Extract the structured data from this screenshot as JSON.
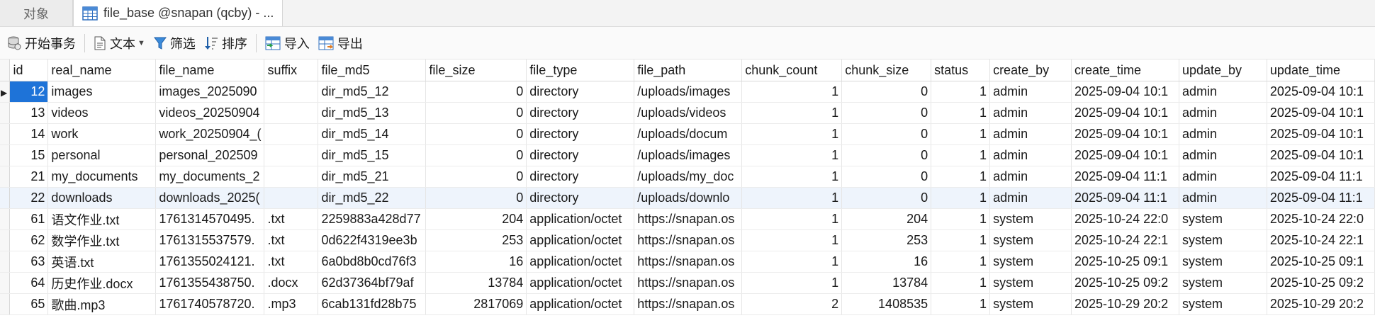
{
  "tabs": {
    "objects_label": "对象",
    "active_label": "file_base @snapan (qcby) - ..."
  },
  "toolbar": {
    "begin_tx": "开始事务",
    "text": "文本",
    "filter": "筛选",
    "sort": "排序",
    "import": "导入",
    "export": "导出"
  },
  "columns": [
    "id",
    "real_name",
    "file_name",
    "suffix",
    "file_md5",
    "file_size",
    "file_type",
    "file_path",
    "chunk_count",
    "chunk_size",
    "status",
    "create_by",
    "create_time",
    "update_by",
    "update_time"
  ],
  "rows": [
    [
      "12",
      "images",
      "images_2025090",
      "",
      "dir_md5_12",
      "0",
      "directory",
      "/uploads/images",
      "1",
      "0",
      "1",
      "admin",
      "2025-09-04 10:1",
      "admin",
      "2025-09-04 10:1"
    ],
    [
      "13",
      "videos",
      "videos_20250904",
      "",
      "dir_md5_13",
      "0",
      "directory",
      "/uploads/videos",
      "1",
      "0",
      "1",
      "admin",
      "2025-09-04 10:1",
      "admin",
      "2025-09-04 10:1"
    ],
    [
      "14",
      "work",
      "work_20250904_(",
      "",
      "dir_md5_14",
      "0",
      "directory",
      "/uploads/docum",
      "1",
      "0",
      "1",
      "admin",
      "2025-09-04 10:1",
      "admin",
      "2025-09-04 10:1"
    ],
    [
      "15",
      "personal",
      "personal_202509",
      "",
      "dir_md5_15",
      "0",
      "directory",
      "/uploads/images",
      "1",
      "0",
      "1",
      "admin",
      "2025-09-04 10:1",
      "admin",
      "2025-09-04 10:1"
    ],
    [
      "21",
      "my_documents",
      "my_documents_2",
      "",
      "dir_md5_21",
      "0",
      "directory",
      "/uploads/my_doc",
      "1",
      "0",
      "1",
      "admin",
      "2025-09-04 11:1",
      "admin",
      "2025-09-04 11:1"
    ],
    [
      "22",
      "downloads",
      "downloads_2025(",
      "",
      "dir_md5_22",
      "0",
      "directory",
      "/uploads/downlo",
      "1",
      "0",
      "1",
      "admin",
      "2025-09-04 11:1",
      "admin",
      "2025-09-04 11:1"
    ],
    [
      "61",
      "语文作业.txt",
      "1761314570495.",
      ".txt",
      "2259883a428d77",
      "204",
      "application/octet",
      "https://snapan.os",
      "1",
      "204",
      "1",
      "system",
      "2025-10-24 22:0",
      "system",
      "2025-10-24 22:0"
    ],
    [
      "62",
      "数学作业.txt",
      "1761315537579.",
      ".txt",
      "0d622f4319ee3b",
      "253",
      "application/octet",
      "https://snapan.os",
      "1",
      "253",
      "1",
      "system",
      "2025-10-24 22:1",
      "system",
      "2025-10-24 22:1"
    ],
    [
      "63",
      "英语.txt",
      "1761355024121.",
      ".txt",
      "6a0bd8b0cd76f3",
      "16",
      "application/octet",
      "https://snapan.os",
      "1",
      "16",
      "1",
      "system",
      "2025-10-25 09:1",
      "system",
      "2025-10-25 09:1"
    ],
    [
      "64",
      "历史作业.docx",
      "1761355438750.",
      ".docx",
      "62d37364bf79af",
      "13784",
      "application/octet",
      "https://snapan.os",
      "1",
      "13784",
      "1",
      "system",
      "2025-10-25 09:2",
      "system",
      "2025-10-25 09:2"
    ],
    [
      "65",
      "歌曲.mp3",
      "1761740578720.",
      ".mp3",
      "6cab131fd28b75",
      "2817069",
      "application/octet",
      "https://snapan.os",
      "2",
      "1408535",
      "1",
      "system",
      "2025-10-29 20:2",
      "system",
      "2025-10-29 20:2"
    ]
  ]
}
